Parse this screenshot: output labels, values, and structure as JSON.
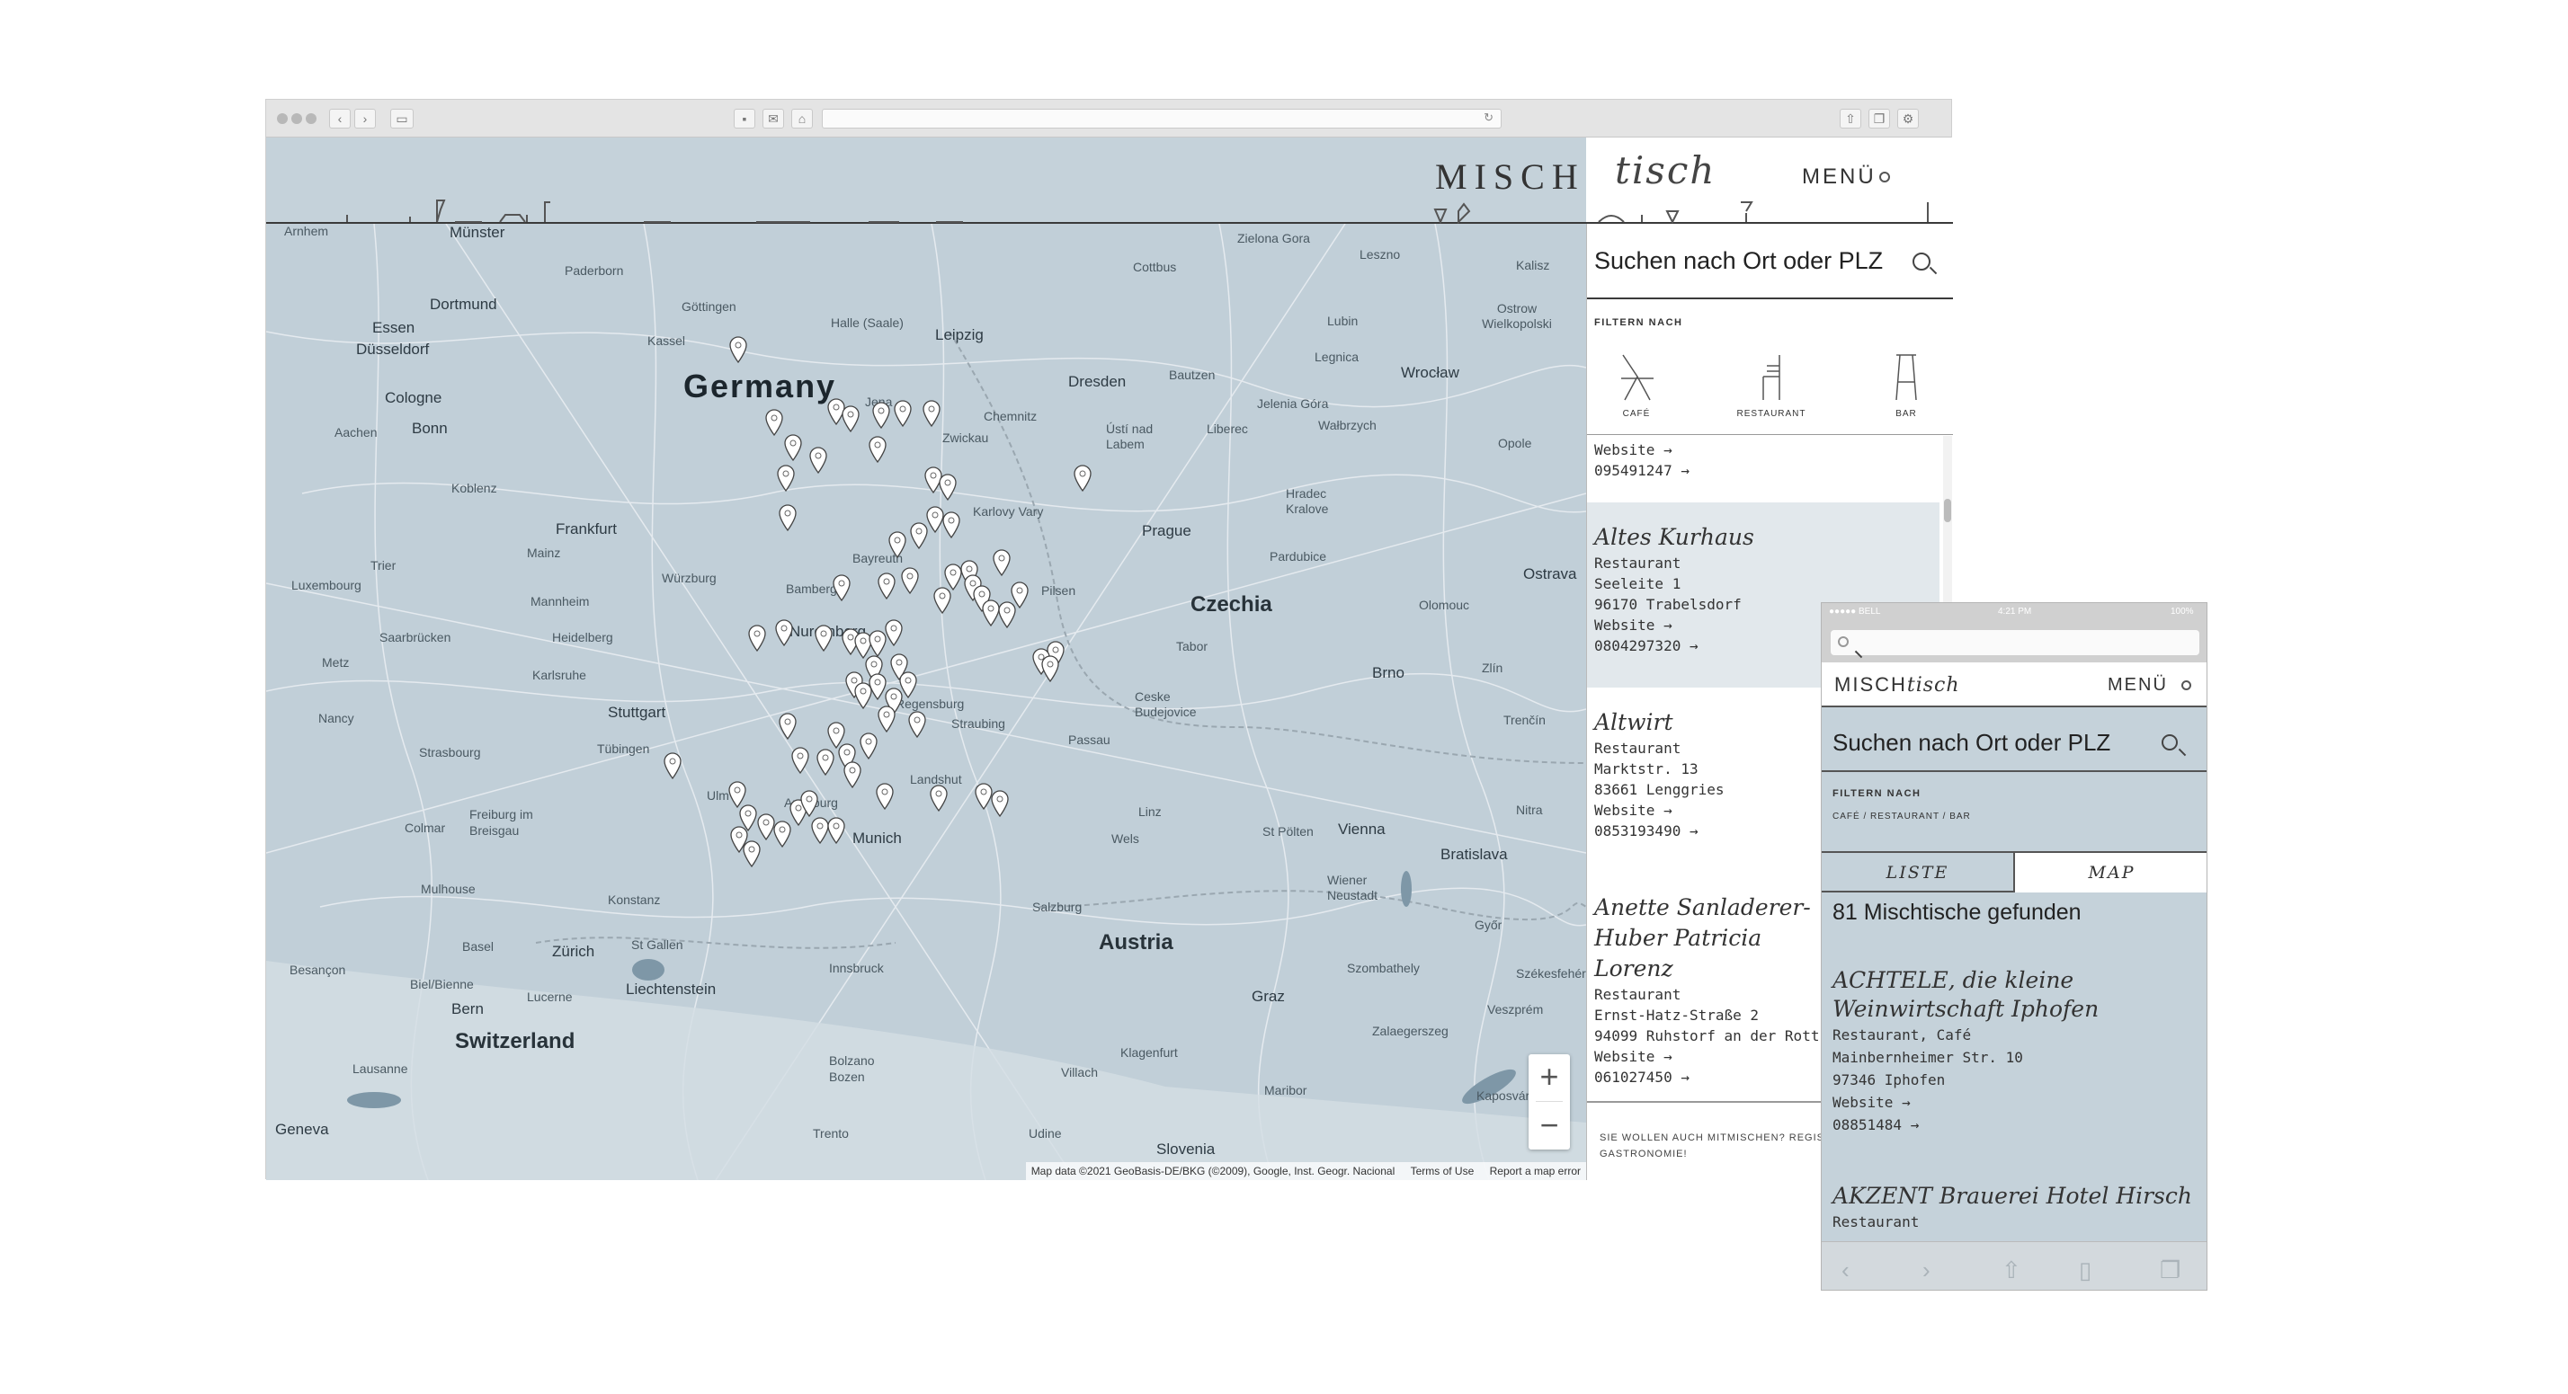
{
  "brand": {
    "misch": "MISCH",
    "tisch": "tisch",
    "menu_label": "MENÜ"
  },
  "search": {
    "placeholder": "Suchen nach Ort oder PLZ"
  },
  "filter": {
    "label": "FILTERN NACH",
    "options": [
      "CAFÉ",
      "RESTAURANT",
      "BAR"
    ]
  },
  "map": {
    "labels": [
      {
        "text": "Arnhem",
        "cls": "small"
      },
      {
        "text": "Münster",
        "cls": ""
      },
      {
        "text": "Paderborn",
        "cls": "small"
      },
      {
        "text": "Essen",
        "cls": ""
      },
      {
        "text": "Dortmund",
        "cls": ""
      },
      {
        "text": "Düsseldorf",
        "cls": ""
      },
      {
        "text": "Cologne",
        "cls": ""
      },
      {
        "text": "Bonn",
        "cls": ""
      },
      {
        "text": "Aachen",
        "cls": "small"
      },
      {
        "text": "Kassel",
        "cls": "small"
      },
      {
        "text": "Göttingen",
        "cls": "small"
      },
      {
        "text": "Halle (Saale)",
        "cls": "small"
      },
      {
        "text": "Leipzig",
        "cls": ""
      },
      {
        "text": "Germany",
        "cls": "big"
      },
      {
        "text": "Jena",
        "cls": "small"
      },
      {
        "text": "Chemnitz",
        "cls": "small"
      },
      {
        "text": "Zwickau",
        "cls": "small"
      },
      {
        "text": "Dresden",
        "cls": ""
      },
      {
        "text": "Bautzen",
        "cls": "small"
      },
      {
        "text": "Koblenz",
        "cls": "small"
      },
      {
        "text": "Frankfurt",
        "cls": ""
      },
      {
        "text": "Mainz",
        "cls": "small"
      },
      {
        "text": "Trier",
        "cls": "small"
      },
      {
        "text": "Luxembourg",
        "cls": "small"
      },
      {
        "text": "Mannheim",
        "cls": "small"
      },
      {
        "text": "Heidelberg",
        "cls": "small"
      },
      {
        "text": "Saarbrücken",
        "cls": "small"
      },
      {
        "text": "Metz",
        "cls": "small"
      },
      {
        "text": "Karlsruhe",
        "cls": "small"
      },
      {
        "text": "Stuttgart",
        "cls": ""
      },
      {
        "text": "Nancy",
        "cls": "small"
      },
      {
        "text": "Strasbourg",
        "cls": "small"
      },
      {
        "text": "Tübingen",
        "cls": "small"
      },
      {
        "text": "Freiburg im Breisgau",
        "cls": "small"
      },
      {
        "text": "Colmar",
        "cls": "small"
      },
      {
        "text": "Mulhouse",
        "cls": "small"
      },
      {
        "text": "Konstanz",
        "cls": "small"
      },
      {
        "text": "Basel",
        "cls": "small"
      },
      {
        "text": "Zürich",
        "cls": ""
      },
      {
        "text": "St Gallen",
        "cls": "small"
      },
      {
        "text": "Liechtenstein",
        "cls": ""
      },
      {
        "text": "Besançon",
        "cls": "small"
      },
      {
        "text": "Bern",
        "cls": ""
      },
      {
        "text": "Biel/Bienne",
        "cls": "small"
      },
      {
        "text": "Lucerne",
        "cls": "small"
      },
      {
        "text": "Switzerland",
        "cls": "country"
      },
      {
        "text": "Lausanne",
        "cls": "small"
      },
      {
        "text": "Geneva",
        "cls": ""
      },
      {
        "text": "Würzburg",
        "cls": "small"
      },
      {
        "text": "Bamberg",
        "cls": "small"
      },
      {
        "text": "Bayreuth",
        "cls": "small"
      },
      {
        "text": "Nuremberg",
        "cls": ""
      },
      {
        "text": "Regensburg",
        "cls": "small"
      },
      {
        "text": "Straubing",
        "cls": "small"
      },
      {
        "text": "Landshut",
        "cls": "small"
      },
      {
        "text": "Ulm",
        "cls": "small"
      },
      {
        "text": "Augsburg",
        "cls": "small"
      },
      {
        "text": "Munich",
        "cls": ""
      },
      {
        "text": "Innsbruck",
        "cls": "small"
      },
      {
        "text": "Salzburg",
        "cls": "small"
      },
      {
        "text": "Passau",
        "cls": "small"
      },
      {
        "text": "Austria",
        "cls": "country"
      },
      {
        "text": "Linz",
        "cls": "small"
      },
      {
        "text": "Wels",
        "cls": "small"
      },
      {
        "text": "St Pölten",
        "cls": "small"
      },
      {
        "text": "Vienna",
        "cls": ""
      },
      {
        "text": "Wiener Neustadt",
        "cls": "small"
      },
      {
        "text": "Bratislava",
        "cls": ""
      },
      {
        "text": "Graz",
        "cls": ""
      },
      {
        "text": "Klagenfurt",
        "cls": "small"
      },
      {
        "text": "Villach",
        "cls": "small"
      },
      {
        "text": "Bolzano Bozen",
        "cls": "small"
      },
      {
        "text": "Trento",
        "cls": "small"
      },
      {
        "text": "Udine",
        "cls": "small"
      },
      {
        "text": "Slovenia",
        "cls": ""
      },
      {
        "text": "Maribor",
        "cls": "small"
      },
      {
        "text": "Szombathely",
        "cls": "small"
      },
      {
        "text": "Zalaegerszeg",
        "cls": "small"
      },
      {
        "text": "Veszprém",
        "cls": "small"
      },
      {
        "text": "Székesfehérvár",
        "cls": "small"
      },
      {
        "text": "Kaposvár",
        "cls": "small"
      },
      {
        "text": "Győr",
        "cls": "small"
      },
      {
        "text": "Nitra",
        "cls": "small"
      },
      {
        "text": "Trenčín",
        "cls": "small"
      },
      {
        "text": "Zlín",
        "cls": "small"
      },
      {
        "text": "Brno",
        "cls": ""
      },
      {
        "text": "Olomouc",
        "cls": "small"
      },
      {
        "text": "Ostrava",
        "cls": ""
      },
      {
        "text": "Czechia",
        "cls": "country"
      },
      {
        "text": "Prague",
        "cls": ""
      },
      {
        "text": "Pilsen",
        "cls": "small"
      },
      {
        "text": "Karlovy Vary",
        "cls": "small"
      },
      {
        "text": "Ústí nad Labem",
        "cls": "small"
      },
      {
        "text": "Liberec",
        "cls": "small"
      },
      {
        "text": "Jelenia Góra",
        "cls": "small"
      },
      {
        "text": "Wałbrzych",
        "cls": "small"
      },
      {
        "text": "Wrocław",
        "cls": ""
      },
      {
        "text": "Opole",
        "cls": "small"
      },
      {
        "text": "Hradec Kralove",
        "cls": "small"
      },
      {
        "text": "Pardubice",
        "cls": "small"
      },
      {
        "text": "Tabor",
        "cls": "small"
      },
      {
        "text": "Ceske Budejovice",
        "cls": "small"
      },
      {
        "text": "Zielona Gora",
        "cls": "small"
      },
      {
        "text": "Leszno",
        "cls": "small"
      },
      {
        "text": "Kalisz",
        "cls": "small"
      },
      {
        "text": "Lubin",
        "cls": "small"
      },
      {
        "text": "Legnica",
        "cls": "small"
      },
      {
        "text": "Ostrow Wielkopolski",
        "cls": "small"
      },
      {
        "text": "Cottbus",
        "cls": "small"
      }
    ],
    "attribution": {
      "data": "Map data ©2021 GeoBasis-DE/BKG (©2009), Google, Inst. Geogr. Nacional",
      "terms": "Terms of Use",
      "report": "Report a map error"
    },
    "zoom_in": "+",
    "zoom_out": "−"
  },
  "desktop_list": [
    {
      "name": "",
      "lines": [
        "Website →",
        "095491247 →"
      ],
      "highlight": false
    },
    {
      "name": "Altes Kurhaus",
      "lines": [
        "Restaurant",
        "Seeleite 1",
        "96170 Trabelsdorf",
        "Website →",
        "0804297320 →"
      ],
      "highlight": true
    },
    {
      "name": "Altwirt",
      "lines": [
        "Restaurant",
        "Marktstr. 13",
        "83661 Lenggries",
        "Website →",
        "0853193490 →"
      ],
      "highlight": false
    },
    {
      "name": "Anette Sanladerer-Huber Patricia Lorenz",
      "lines": [
        "Restaurant",
        "Ernst-Hatz-Straße 2",
        "94099 Ruhstorf an der Rott",
        "Website →",
        "061027450 →"
      ],
      "highlight": false
    }
  ],
  "sidebar_footer": "SIE WOLLEN AUCH MITMISCHEN? REGISTRIERE HIER DEINE GASTRONOMIE!",
  "mobile": {
    "status_carrier": "●●●●● BELL",
    "status_time": "4:21 PM",
    "status_battery": "100%",
    "filter_options_text": "CAFÉ  /  RESTAURANT  /  BAR",
    "tab_list": "LISTE",
    "tab_map": "MAP",
    "result_count": "81 Mischtische gefunden",
    "entries": [
      {
        "name": "ACHTELE, die kleine Weinwirtschaft Iphofen",
        "lines": [
          "Restaurant, Café",
          "Mainbernheimer Str. 10",
          "97346 Iphofen",
          "Website →",
          "08851484 →"
        ]
      },
      {
        "name": "AKZENT Brauerei Hotel Hirsch",
        "lines": [
          "Restaurant"
        ]
      }
    ]
  }
}
